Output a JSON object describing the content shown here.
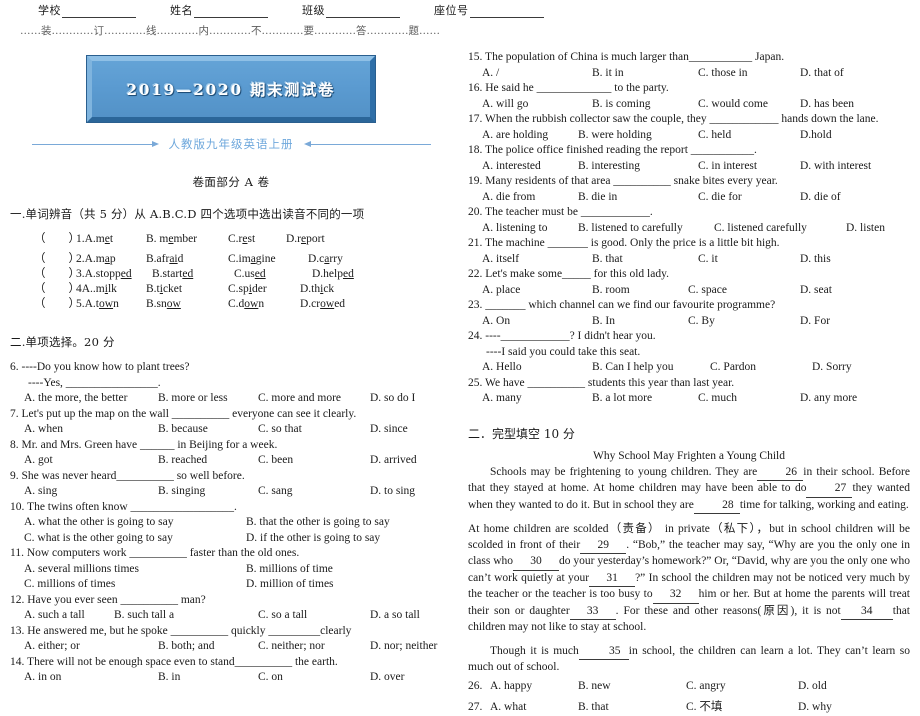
{
  "header": {
    "fields": [
      {
        "label": "学校"
      },
      {
        "label": "姓名"
      },
      {
        "label": "班级"
      },
      {
        "label": "座位号"
      }
    ],
    "seal_line": "……装…………订…………线…………内…………不…………要…………答…………题……"
  },
  "banner": {
    "title": "2019—2020 期末测试卷",
    "subtitle": "人教版九年级英语上册",
    "banner_color": "#5b9bd1",
    "arrow_color": "#7aa9d8",
    "subtitle_color": "#6fa8dc"
  },
  "paper_part": "卷面部分 A 卷",
  "section_one": {
    "heading": "一.单词辨音（共 5 分）从 A.B.C.D 四个选项中选出读音不同的一项",
    "questions": [
      {
        "num": "1.",
        "options": [
          "A.m<u>e</u>t",
          "B. m<u>e</u>mber",
          "C.r<u>e</u>st",
          "D.r<u>e</u>port"
        ]
      },
      {
        "num": "2.",
        "options": [
          "A.m<u>a</u>p",
          "B.afr<u>ai</u>d",
          "C.im<u>a</u>gine",
          "D.c<u>a</u>rry"
        ]
      },
      {
        "num": "3.",
        "options": [
          "A.stopp<u>ed</u>",
          "B.start<u>ed</u>",
          "C.us<u>ed</u>",
          "D.help<u>ed</u>"
        ]
      },
      {
        "num": "4",
        "options": [
          "A..m<u>i</u>lk",
          "B.t<u>i</u>cket",
          "C.sp<u>i</u>der",
          "D.th<u>i</u>ck"
        ]
      },
      {
        "num": "5.",
        "options": [
          "A.t<u>ow</u>n",
          "B.sn<u>ow</u>",
          "C.d<u>ow</u>n",
          "D.cr<u>ow</u>ed"
        ]
      }
    ]
  },
  "section_two": {
    "heading": "二.单项选择。20 分",
    "questions": [
      {
        "num": "6.",
        "stem_lines": [
          "6. ----Do you know how to plant trees?",
          "----Yes, ________________."
        ],
        "options": [
          "A. the more, the better",
          "B. more or less",
          "C. more and more",
          "D. so do I"
        ]
      },
      {
        "num": "7.",
        "stem_lines": [
          "7. Let's put up the map on the wall __________ everyone can see it clearly."
        ],
        "options": [
          "A. when",
          "B. because",
          "C. so that",
          "D. since"
        ]
      },
      {
        "num": "8.",
        "stem_lines": [
          "8. Mr. and Mrs. Green have ______ in Beijing for a week."
        ],
        "options": [
          "A. got",
          "B. reached",
          "C. been",
          "D. arrived"
        ]
      },
      {
        "num": "9.",
        "stem_lines": [
          "9. She was never heard__________ so well before."
        ],
        "options": [
          "A. sing",
          "B. singing",
          "C. sang",
          "D. to sing"
        ]
      },
      {
        "num": "10.",
        "stem_lines": [
          "10. The twins often know __________________."
        ],
        "options_grid": [
          [
            "A. what the other is going to say",
            "B. that the other is going to say"
          ],
          [
            "C. what is the other going to say",
            "D. if the other is going to say"
          ]
        ]
      },
      {
        "num": "11.",
        "stem_lines": [
          "11. Now computers work __________ faster than the old ones."
        ],
        "options_grid": [
          [
            "A. several millions times",
            "B. millions of time"
          ],
          [
            "C. millions of times",
            "D. million of times"
          ]
        ]
      },
      {
        "num": "12.",
        "stem_lines": [
          "12. Have you ever seen __________ man?"
        ],
        "options": [
          "A. such a tall",
          "B. such tall a",
          "C. so a tall",
          "D. a so tall"
        ]
      },
      {
        "num": "13.",
        "stem_lines": [
          "13. He answered me, but he spoke __________ quickly _________clearly"
        ],
        "options": [
          "A. either; or",
          "B. both; and",
          "C. neither; nor",
          "D. nor; neither"
        ]
      },
      {
        "num": "14.",
        "stem_lines": [
          "14. There will not be enough space even to stand__________ the earth."
        ],
        "options": [
          "A. in on",
          "B. in",
          "C. on",
          "D. over"
        ]
      },
      {
        "num": "15.",
        "stem_lines": [
          "15. The population of China is much larger than___________ Japan."
        ],
        "options": [
          "A. /",
          "B. it in",
          "C. those in",
          "D. that of"
        ]
      },
      {
        "num": "16.",
        "stem_lines": [
          "16. He said he _____________ to the party."
        ],
        "options": [
          "A. will go",
          "B. is coming",
          "C. would come",
          "D. has been"
        ]
      },
      {
        "num": "17.",
        "stem_lines": [
          "17. When the rubbish collector saw the couple, they ____________ hands down the lane."
        ],
        "options": [
          "A. are holding",
          "B. were holding",
          "C. held",
          "D.hold"
        ]
      },
      {
        "num": "18.",
        "stem_lines": [
          "18. The police office finished reading the report ___________."
        ],
        "options": [
          "A. interested",
          "B. interesting",
          "C. in interest",
          "D. with interest"
        ]
      },
      {
        "num": "19.",
        "stem_lines": [
          "19. Many residents of that area __________ snake bites every year."
        ],
        "options": [
          "A. die from",
          "B. die in",
          "C. die for",
          "D. die of"
        ]
      },
      {
        "num": "20.",
        "stem_lines": [
          "20. The teacher must be ____________."
        ],
        "options": [
          "A. listening to",
          "B. listened to carefully",
          "C. listened carefully",
          "D. listen"
        ]
      },
      {
        "num": "21.",
        "stem_lines": [
          "21. The machine _______ is good. Only the price is a little bit high."
        ],
        "options": [
          "A. itself",
          "B. that",
          "C. it",
          "D. this"
        ]
      },
      {
        "num": "22.",
        "stem_lines": [
          "22. Let's make some_____ for this old lady."
        ],
        "options": [
          "A. place",
          "B. room",
          "C. space",
          "D. seat"
        ]
      },
      {
        "num": "23.",
        "stem_lines": [
          "23. _______ which channel can we find our favourite programme?"
        ],
        "options": [
          "A. On",
          "B. In",
          "C. By",
          "D. For"
        ]
      },
      {
        "num": "24.",
        "stem_lines": [
          "24. ----____________? I didn't hear you.",
          "----I said you could take this seat."
        ],
        "options": [
          "A. Hello",
          "B. Can I help you",
          "C. Pardon",
          "D. Sorry"
        ]
      },
      {
        "num": "25.",
        "stem_lines": [
          "25. We have __________ students this year than last year."
        ],
        "options": [
          "A. many",
          "B. a lot more",
          "C. much",
          "D. any more"
        ]
      }
    ]
  },
  "section_three": {
    "heading": "二．完型填空 10 分",
    "passage_title": "Why School May Frighten a Young Child",
    "paragraphs": [
      {
        "indent": true,
        "parts": [
          {
            "t": "text",
            "v": "Schools may be frightening to young children. They are"
          },
          {
            "t": "gap",
            "v": "26"
          },
          {
            "t": "text",
            "v": "in their school. Before that they stayed at home. At home children may have been able to do"
          },
          {
            "t": "gap",
            "v": "27"
          },
          {
            "t": "text",
            "v": "they wanted when they wanted to do it. But in school they are"
          },
          {
            "t": "gap",
            "v": "28"
          },
          {
            "t": "text",
            "v": "time for talking, working and eating."
          }
        ]
      },
      {
        "indent": false,
        "parts": [
          {
            "t": "text",
            "v": "At home children are scolded（责备） in private（私下），but in school children will be scolded in front of their"
          },
          {
            "t": "gap",
            "v": "29"
          },
          {
            "t": "text",
            "v": ". “Bob,” the teacher may say, “Why are you the only one in class who"
          },
          {
            "t": "gap",
            "v": "30"
          },
          {
            "t": "text",
            "v": "do your yesterday’s homework?” Or, “David, why are you the only one who can’t work quietly at your"
          },
          {
            "t": "gap",
            "v": "31"
          },
          {
            "t": "text",
            "v": "?” In school the children may not be noticed very much by the teacher or the teacher is too busy to"
          },
          {
            "t": "gap",
            "v": "32"
          },
          {
            "t": "text",
            "v": "him or her. But at home the parents will treat their son or daughter"
          },
          {
            "t": "gap",
            "v": "33"
          },
          {
            "t": "text",
            "v": ". For these and other reasons(原因), it is not"
          },
          {
            "t": "gap",
            "v": "34"
          },
          {
            "t": "text",
            "v": "that children may not like to stay at school."
          }
        ]
      },
      {
        "indent": true,
        "parts": [
          {
            "t": "text",
            "v": "Though it is much"
          },
          {
            "t": "gap",
            "v": "35"
          },
          {
            "t": "text",
            "v": "in school, the children can learn a lot. They can’t learn so much out of school."
          }
        ]
      }
    ],
    "questions": [
      {
        "num": "26.",
        "options": [
          "A. happy",
          "B. new",
          "C. angry",
          "D. old"
        ]
      },
      {
        "num": "27.",
        "options": [
          "A. what",
          "B. that",
          "C. 不填",
          "D. why"
        ]
      }
    ]
  }
}
